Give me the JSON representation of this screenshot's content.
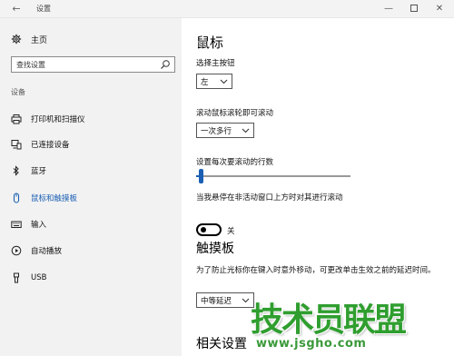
{
  "titlebar": {
    "app_title": "设置",
    "back_glyph": "←",
    "minimize_glyph": "—",
    "close_glyph": "✕"
  },
  "sidebar": {
    "home_label": "主页",
    "search_placeholder": "查找设置",
    "section_label": "设备",
    "items": [
      {
        "label": "打印机和扫描仪",
        "icon": "printer-icon"
      },
      {
        "label": "已连接设备",
        "icon": "connected-devices-icon"
      },
      {
        "label": "蓝牙",
        "icon": "bluetooth-icon"
      },
      {
        "label": "鼠标和触摸板",
        "icon": "mouse-icon",
        "active": true
      },
      {
        "label": "输入",
        "icon": "keyboard-icon"
      },
      {
        "label": "自动播放",
        "icon": "autoplay-icon"
      },
      {
        "label": "USB",
        "icon": "usb-icon"
      }
    ]
  },
  "main": {
    "title": "鼠标",
    "primary_button_label": "选择主按钮",
    "primary_button_value": "左",
    "scroll_label": "滚动鼠标滚轮即可滚动",
    "scroll_value": "一次多行",
    "lines_label": "设置每次要滚动的行数",
    "lines_level": 0.02,
    "inactive_scroll_label": "当我悬停在非活动窗口上方时对其进行滚动",
    "inactive_scroll_state": "关",
    "touchpad_title": "触摸板",
    "touchpad_desc": "为了防止光标你在键入时意外移动，可更改单击生效之前的延迟时间。",
    "delay_value": "中等延迟",
    "related_title": "相关设置"
  },
  "watermark": {
    "brand": "技术员联盟",
    "url": "www.jsgho.com"
  },
  "colors": {
    "accent": "#1a5fb4",
    "sidebar_bg": "#f2f2f2",
    "watermark_green": "#2f9e2f"
  }
}
